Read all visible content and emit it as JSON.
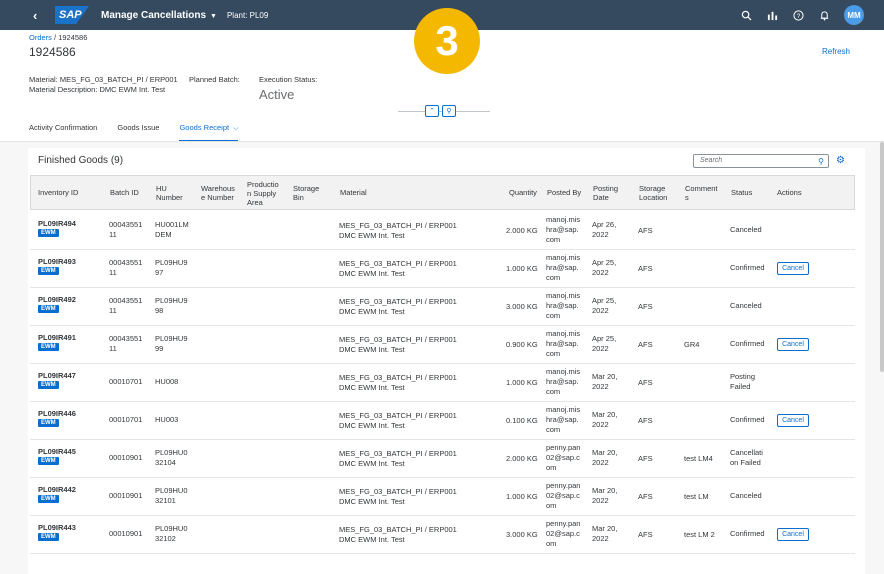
{
  "shell": {
    "app_title": "Manage Cancellations",
    "plant": "Plant: PL09",
    "logo": "SAP",
    "avatar": "MM"
  },
  "step_badge": "3",
  "header": {
    "breadcrumb_link": "Orders",
    "breadcrumb_sep": " / ",
    "breadcrumb_current": "1924586",
    "title": "1924586",
    "refresh": "Refresh",
    "material": "Material: MES_FG_03_BATCH_PI / ERP001",
    "material_desc": "Material Description: DMC EWM Int. Test",
    "planned_batch": "Planned Batch:",
    "execution_status_label": "Execution Status:",
    "execution_status": "Active"
  },
  "tabs": [
    "Activity Confirmation",
    "Goods Issue",
    "Goods Receipt"
  ],
  "card": {
    "title": "Finished Goods (9)",
    "search_placeholder": "Search"
  },
  "columns": {
    "inventory_id": "Inventory ID",
    "batch_id": "Batch ID",
    "hu_number_1": "HU",
    "hu_number_2": "Number",
    "warehouse_1": "Warehous",
    "warehouse_2": "e Number",
    "psa_1": "Productio",
    "psa_2": "n Supply",
    "psa_3": "Area",
    "storage_bin_1": "Storage",
    "storage_bin_2": "Bin",
    "material": "Material",
    "quantity": "Quantity",
    "posted_by": "Posted By",
    "posting_date_1": "Posting",
    "posting_date_2": "Date",
    "storage_loc_1": "Storage",
    "storage_loc_2": "Location",
    "comments_1": "Comment",
    "comments_2": "s",
    "status": "Status",
    "actions": "Actions"
  },
  "rows": [
    {
      "inv": "PL09IR494",
      "badge": "EWM",
      "batch": [
        "00043551",
        "11"
      ],
      "hu": [
        "HU001LM",
        "DEM"
      ],
      "mat1": "MES_FG_03_BATCH_PI / ERP001",
      "mat2": "DMC EWM Int. Test",
      "qty": "2.000 KG",
      "posted": [
        "manoj.mis",
        "hra@sap.",
        "com"
      ],
      "date": [
        "Apr 26,",
        "2022"
      ],
      "loc": "AFS",
      "comment": "",
      "status": [
        "Canceled"
      ],
      "cancel": ""
    },
    {
      "inv": "PL09IR493",
      "badge": "EWM",
      "batch": [
        "00043551",
        "11"
      ],
      "hu": [
        "PL09HU9",
        "97"
      ],
      "mat1": "MES_FG_03_BATCH_PI / ERP001",
      "mat2": "DMC EWM Int. Test",
      "qty": "1.000 KG",
      "posted": [
        "manoj.mis",
        "hra@sap.",
        "com"
      ],
      "date": [
        "Apr 25,",
        "2022"
      ],
      "loc": "AFS",
      "comment": "",
      "status": [
        "Confirmed"
      ],
      "cancel": "Cancel"
    },
    {
      "inv": "PL09IR492",
      "badge": "EWM",
      "batch": [
        "00043551",
        "11"
      ],
      "hu": [
        "PL09HU9",
        "98"
      ],
      "mat1": "MES_FG_03_BATCH_PI / ERP001",
      "mat2": "DMC EWM Int. Test",
      "qty": "3.000 KG",
      "posted": [
        "manoj.mis",
        "hra@sap.",
        "com"
      ],
      "date": [
        "Apr 25,",
        "2022"
      ],
      "loc": "AFS",
      "comment": "",
      "status": [
        "Canceled"
      ],
      "cancel": ""
    },
    {
      "inv": "PL09IR491",
      "badge": "EWM",
      "batch": [
        "00043551",
        "11"
      ],
      "hu": [
        "PL09HU9",
        "99"
      ],
      "mat1": "MES_FG_03_BATCH_PI / ERP001",
      "mat2": "DMC EWM Int. Test",
      "qty": "0.900 KG",
      "posted": [
        "manoj.mis",
        "hra@sap.",
        "com"
      ],
      "date": [
        "Apr 25,",
        "2022"
      ],
      "loc": "AFS",
      "comment": "GR4",
      "status": [
        "Confirmed"
      ],
      "cancel": "Cancel"
    },
    {
      "inv": "PL09IR447",
      "badge": "EWM",
      "batch": [
        "00010701"
      ],
      "hu": [
        "HU008"
      ],
      "mat1": "MES_FG_03_BATCH_PI / ERP001",
      "mat2": "DMC EWM Int. Test",
      "qty": "1.000 KG",
      "posted": [
        "manoj.mis",
        "hra@sap.",
        "com"
      ],
      "date": [
        "Mar 20,",
        "2022"
      ],
      "loc": "AFS",
      "comment": "",
      "status": [
        "Posting",
        "Failed"
      ],
      "cancel": ""
    },
    {
      "inv": "PL09IR446",
      "badge": "EWM",
      "batch": [
        "00010701"
      ],
      "hu": [
        "HU003"
      ],
      "mat1": "MES_FG_03_BATCH_PI / ERP001",
      "mat2": "DMC EWM Int. Test",
      "qty": "0.100 KG",
      "posted": [
        "manoj.mis",
        "hra@sap.",
        "com"
      ],
      "date": [
        "Mar 20,",
        "2022"
      ],
      "loc": "AFS",
      "comment": "",
      "status": [
        "Confirmed"
      ],
      "cancel": "Cancel"
    },
    {
      "inv": "PL09IR445",
      "badge": "EWM",
      "batch": [
        "00010901"
      ],
      "hu": [
        "PL09HU0",
        "32104"
      ],
      "mat1": "MES_FG_03_BATCH_PI / ERP001",
      "mat2": "DMC EWM Int. Test",
      "qty": "2.000 KG",
      "posted": [
        "penny.pan",
        "02@sap.c",
        "om"
      ],
      "date": [
        "Mar 20,",
        "2022"
      ],
      "loc": "AFS",
      "comment": "test LM4",
      "status": [
        "Cancellati",
        "on Failed"
      ],
      "cancel": ""
    },
    {
      "inv": "PL09IR442",
      "badge": "EWM",
      "batch": [
        "00010901"
      ],
      "hu": [
        "PL09HU0",
        "32101"
      ],
      "mat1": "MES_FG_03_BATCH_PI / ERP001",
      "mat2": "DMC EWM Int. Test",
      "qty": "1.000 KG",
      "posted": [
        "penny.pan",
        "02@sap.c",
        "om"
      ],
      "date": [
        "Mar 20,",
        "2022"
      ],
      "loc": "AFS",
      "comment": "test LM",
      "status": [
        "Canceled"
      ],
      "cancel": ""
    },
    {
      "inv": "PL09IR443",
      "badge": "EWM",
      "batch": [
        "00010901"
      ],
      "hu": [
        "PL09HU0",
        "32102"
      ],
      "mat1": "MES_FG_03_BATCH_PI / ERP001",
      "mat2": "DMC EWM Int. Test",
      "qty": "3.000 KG",
      "posted": [
        "penny.pan",
        "02@sap.c",
        "om"
      ],
      "date": [
        "Mar 20,",
        "2022"
      ],
      "loc": "AFS",
      "comment": "test LM 2",
      "status": [
        "Confirmed"
      ],
      "cancel": "Cancel"
    }
  ]
}
